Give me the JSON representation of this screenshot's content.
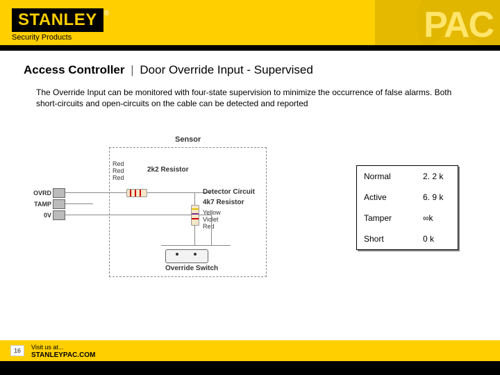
{
  "header": {
    "brand_main": "STANLEY",
    "brand_reg": "®",
    "brand_sub": "Security Products",
    "brand_right": "PAC"
  },
  "title": {
    "bold": "Access Controller",
    "sep": "|",
    "rest": "Door Override Input - Supervised"
  },
  "body_text": "The Override Input can be monitored with four-state supervision to minimize the occurrence of false alarms. Both short-circuits and open-circuits on the cable can be detected and reported",
  "diagram": {
    "sensor_label": "Sensor",
    "terminals": [
      "OVRD",
      "TAMP",
      "0V"
    ],
    "r22": {
      "name": "2k2 Resistor",
      "bands": [
        "Red",
        "Red",
        "Red"
      ]
    },
    "detector_label": "Detector Circuit",
    "r47": {
      "name": "4k7 Resistor",
      "bands": [
        "Yellow",
        "Violet",
        "Red"
      ]
    },
    "switch_label": "Override Switch"
  },
  "state_table": [
    {
      "name": "Normal",
      "val": "2. 2 k"
    },
    {
      "name": "Active",
      "val": "6. 9 k"
    },
    {
      "name": "Tamper",
      "val": "∞k"
    },
    {
      "name": "Short",
      "val": "0 k"
    }
  ],
  "footer": {
    "slide_num": "16",
    "visit_label": "Visit us at...",
    "visit_url": "STANLEYPAC.COM"
  }
}
